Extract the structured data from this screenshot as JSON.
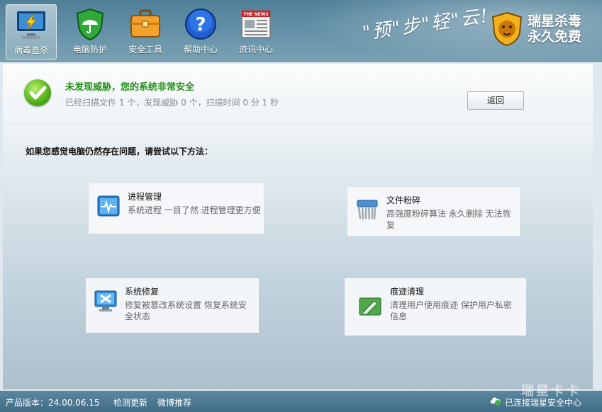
{
  "nav": {
    "items": [
      {
        "label": "病毒查杀",
        "icon": "virus-scan-monitor-icon"
      },
      {
        "label": "电脑防护",
        "icon": "shield-umbrella-icon"
      },
      {
        "label": "安全工具",
        "icon": "toolbox-icon"
      },
      {
        "label": "帮助中心",
        "icon": "help-question-icon"
      },
      {
        "label": "资讯中心",
        "icon": "newspaper-icon",
        "badge": "THE NEWS"
      }
    ]
  },
  "header": {
    "slogan": "\"预\"步\"轻\"云!",
    "brand_line1": "瑞星杀毒",
    "brand_line2": "永久免费"
  },
  "status": {
    "title": "未发现威胁，您的系统非常安全",
    "summary": "已经扫描文件 1 个，发现威胁 0 个，扫描时间 0 分 1 秒",
    "back_button": "返回"
  },
  "main": {
    "prompt": "如果您感觉电脑仍然存在问题，请尝试以下方法：",
    "tools": [
      {
        "name": "进程管理",
        "desc": "系统进程 一目了然 进程管理更方便",
        "icon": "process-monitor-icon"
      },
      {
        "name": "文件粉碎",
        "desc": "高强度粉碎算法 永久删除 无法恢复",
        "icon": "file-shredder-icon"
      },
      {
        "name": "系统修复",
        "desc": "修复被篡改系统设置 恢复系统安全状态",
        "icon": "system-repair-icon"
      },
      {
        "name": "痕迹清理",
        "desc": "清理用户使用痕迹 保护用户私密信息",
        "icon": "trace-cleaner-icon"
      }
    ]
  },
  "footer": {
    "version": "产品版本：24.00.06.15",
    "check_update": "检测更新",
    "weibo": "微博推荐",
    "cloud_status": "已连接瑞星安全中心",
    "watermark": "瑞星卡卡"
  },
  "colors": {
    "accent_green": "#1f8f12",
    "topbar": "#5c87a0"
  }
}
